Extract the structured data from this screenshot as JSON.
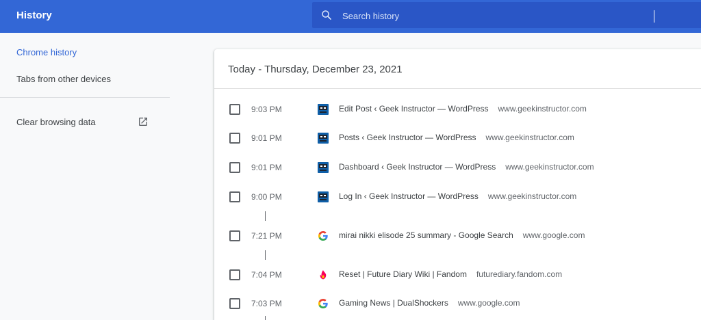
{
  "header": {
    "title": "History",
    "search_placeholder": "Search history"
  },
  "sidebar": {
    "items": [
      {
        "label": "Chrome history"
      },
      {
        "label": "Tabs from other devices"
      },
      {
        "label": "Clear browsing data"
      }
    ]
  },
  "main": {
    "date_header": "Today - Thursday, December 23, 2021",
    "entries": [
      {
        "time": "9:03 PM",
        "title": "Edit Post ‹ Geek Instructor — WordPress",
        "domain": "www.geekinstructor.com",
        "icon": "geekinstructor-favicon-icon"
      },
      {
        "time": "9:01 PM",
        "title": "Posts ‹ Geek Instructor — WordPress",
        "domain": "www.geekinstructor.com",
        "icon": "geekinstructor-favicon-icon"
      },
      {
        "time": "9:01 PM",
        "title": "Dashboard ‹ Geek Instructor — WordPress",
        "domain": "www.geekinstructor.com",
        "icon": "geekinstructor-favicon-icon"
      },
      {
        "time": "9:00 PM",
        "title": "Log In ‹ Geek Instructor — WordPress",
        "domain": "www.geekinstructor.com",
        "icon": "geekinstructor-favicon-icon"
      },
      {
        "time": "7:21 PM",
        "title": "mirai nikki elisode 25 summary - Google Search",
        "domain": "www.google.com",
        "icon": "google-favicon-icon"
      },
      {
        "time": "7:04 PM",
        "title": "Reset | Future Diary Wiki | Fandom",
        "domain": "futurediary.fandom.com",
        "icon": "fandom-favicon-icon"
      },
      {
        "time": "7:03 PM",
        "title": "Gaming News | DualShockers",
        "domain": "www.google.com",
        "icon": "google-favicon-icon"
      }
    ]
  },
  "colors": {
    "topbar": "#3367d6",
    "search_bg": "#2a56c6",
    "active_link": "#3367d6"
  }
}
